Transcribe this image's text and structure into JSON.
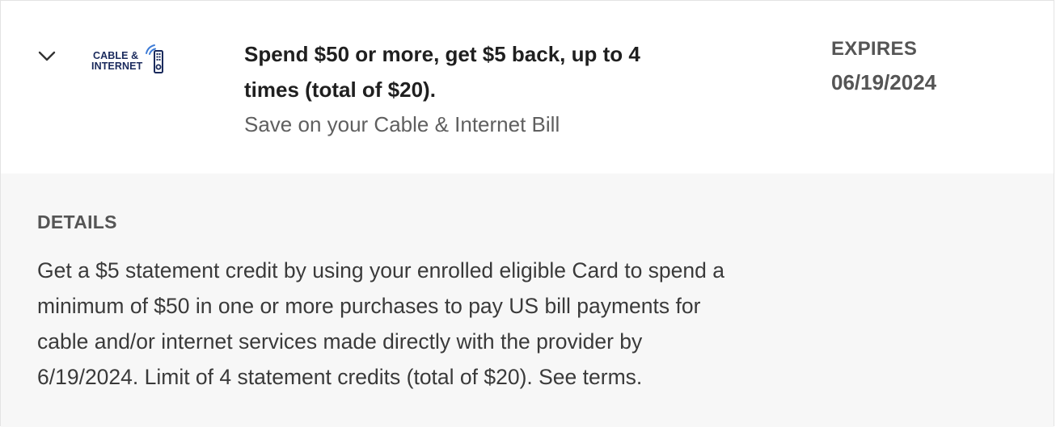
{
  "offer": {
    "logo": {
      "line1": "CABLE &",
      "line2": "INTERNET",
      "icon": "wifi-remote-icon",
      "color": "#1a2a5c",
      "accent": "#3d7bd6"
    },
    "title_line1": "Spend $50 or more, get $5 back, up to 4",
    "title_line2": "times (total of $20).",
    "subtitle": "Save on your Cable & Internet Bill",
    "expires_label": "EXPIRES",
    "expires_date": "06/19/2024",
    "expand_icon": "chevron-down-icon"
  },
  "details": {
    "heading": "DETAILS",
    "line1": "Get a $5 statement credit by using your enrolled eligible Card to spend a",
    "line2": "minimum of $50 in one or more purchases to pay US bill payments for",
    "line3": "cable and/or internet services made directly with the provider by",
    "line4": "6/19/2024. Limit of 4 statement credits (total of $20). See terms."
  }
}
